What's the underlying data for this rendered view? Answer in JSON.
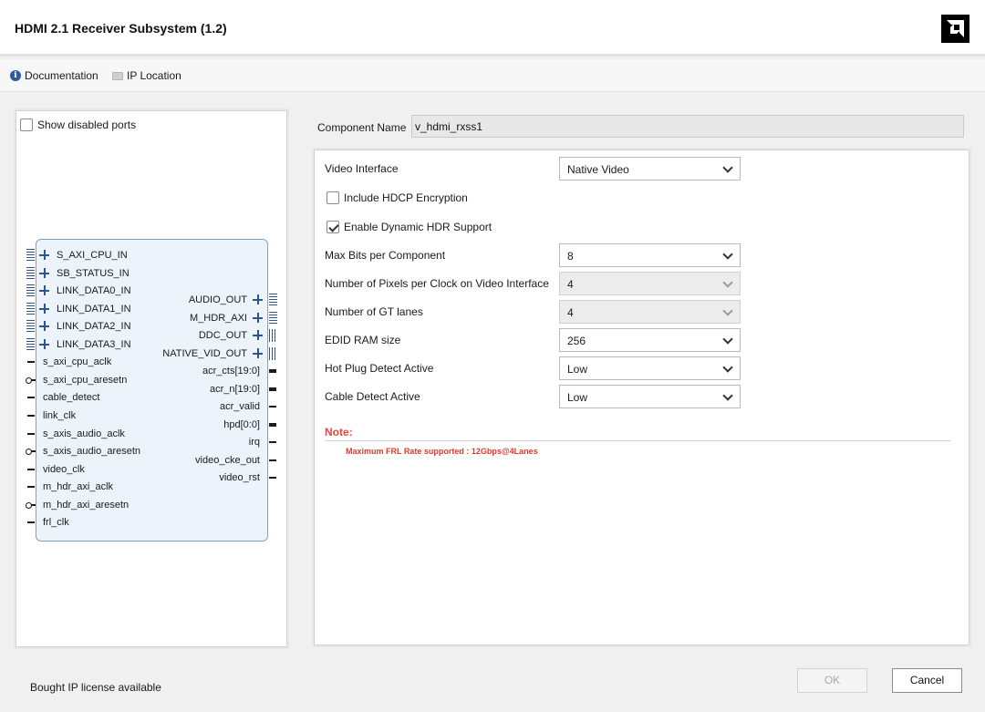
{
  "window": {
    "title": "HDMI 2.1 Receiver Subsystem (1.2)",
    "logo_icon": "amd-logo-icon"
  },
  "toolbar": {
    "documentation": "Documentation",
    "ip_location": "IP Location"
  },
  "symbol": {
    "show_disabled_ports_label": "Show disabled ports",
    "show_disabled_ports_checked": false,
    "left_ports": [
      {
        "name": "S_AXI_CPU_IN",
        "kind": "bus"
      },
      {
        "name": "SB_STATUS_IN",
        "kind": "bus"
      },
      {
        "name": "LINK_DATA0_IN",
        "kind": "bus"
      },
      {
        "name": "LINK_DATA1_IN",
        "kind": "bus"
      },
      {
        "name": "LINK_DATA2_IN",
        "kind": "bus"
      },
      {
        "name": "LINK_DATA3_IN",
        "kind": "bus"
      },
      {
        "name": "s_axi_cpu_aclk",
        "kind": "wire"
      },
      {
        "name": "s_axi_cpu_aresetn",
        "kind": "inverted"
      },
      {
        "name": "cable_detect",
        "kind": "wire"
      },
      {
        "name": "link_clk",
        "kind": "wire"
      },
      {
        "name": "s_axis_audio_aclk",
        "kind": "wire"
      },
      {
        "name": "s_axis_audio_aresetn",
        "kind": "inverted"
      },
      {
        "name": "video_clk",
        "kind": "wire"
      },
      {
        "name": "m_hdr_axi_aclk",
        "kind": "wire"
      },
      {
        "name": "m_hdr_axi_aresetn",
        "kind": "inverted"
      },
      {
        "name": "frl_clk",
        "kind": "wire"
      }
    ],
    "right_ports": [
      {
        "name": "AUDIO_OUT",
        "kind": "bus"
      },
      {
        "name": "M_HDR_AXI",
        "kind": "bus"
      },
      {
        "name": "DDC_OUT",
        "kind": "bus"
      },
      {
        "name": "NATIVE_VID_OUT",
        "kind": "bus"
      },
      {
        "name": "acr_cts[19:0]",
        "kind": "vector"
      },
      {
        "name": "acr_n[19:0]",
        "kind": "vector"
      },
      {
        "name": "acr_valid",
        "kind": "wire"
      },
      {
        "name": "hpd[0:0]",
        "kind": "vector"
      },
      {
        "name": "irq",
        "kind": "wire"
      },
      {
        "name": "video_cke_out",
        "kind": "wire"
      },
      {
        "name": "video_rst",
        "kind": "wire"
      }
    ]
  },
  "component": {
    "label": "Component Name",
    "value": "v_hdmi_rxss1"
  },
  "form": {
    "video_interface": {
      "label": "Video Interface",
      "value": "Native Video",
      "disabled": false
    },
    "include_hdcp": {
      "label": "Include HDCP Encryption",
      "checked": false
    },
    "enable_hdr": {
      "label": "Enable Dynamic HDR Support",
      "checked": true
    },
    "max_bits": {
      "label": "Max Bits per Component",
      "value": "8",
      "disabled": false
    },
    "pixels_per_clock": {
      "label": "Number of Pixels per Clock on Video Interface",
      "value": "4",
      "disabled": true
    },
    "gt_lanes": {
      "label": "Number of GT lanes",
      "value": "4",
      "disabled": true
    },
    "edid_ram": {
      "label": "EDID RAM size",
      "value": "256",
      "disabled": false
    },
    "hot_plug": {
      "label": "Hot Plug Detect Active",
      "value": "Low",
      "disabled": false
    },
    "cable_detect": {
      "label": "Cable Detect Active",
      "value": "Low",
      "disabled": false
    },
    "note_title": "Note:",
    "note_text": "Maximum FRL Rate supported : 12Gbps@4Lanes"
  },
  "footer": {
    "license_text": "Bought IP license available",
    "ok_label": "OK",
    "ok_disabled": true,
    "cancel_label": "Cancel"
  },
  "colors": {
    "note_red": "#e8473f",
    "block_fill": "#ecf3fb",
    "block_border": "#7fa3cc",
    "bus_pin": "#2a5590"
  }
}
